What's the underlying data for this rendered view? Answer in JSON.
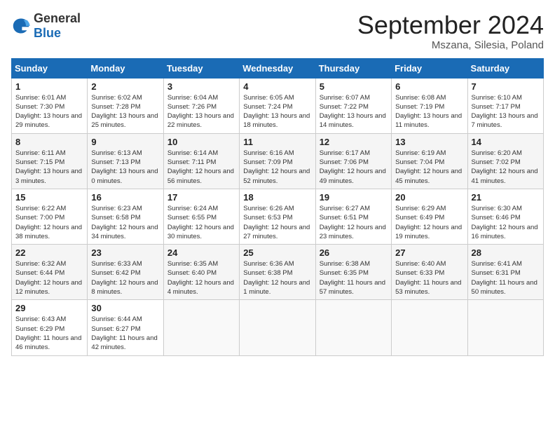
{
  "header": {
    "logo_general": "General",
    "logo_blue": "Blue",
    "month_title": "September 2024",
    "location": "Mszana, Silesia, Poland"
  },
  "calendar": {
    "days_of_week": [
      "Sunday",
      "Monday",
      "Tuesday",
      "Wednesday",
      "Thursday",
      "Friday",
      "Saturday"
    ],
    "weeks": [
      [
        null,
        {
          "day": 2,
          "sunrise": "6:02 AM",
          "sunset": "7:28 PM",
          "daylight": "13 hours and 25 minutes."
        },
        {
          "day": 3,
          "sunrise": "6:04 AM",
          "sunset": "7:26 PM",
          "daylight": "13 hours and 22 minutes."
        },
        {
          "day": 4,
          "sunrise": "6:05 AM",
          "sunset": "7:24 PM",
          "daylight": "13 hours and 18 minutes."
        },
        {
          "day": 5,
          "sunrise": "6:07 AM",
          "sunset": "7:22 PM",
          "daylight": "13 hours and 14 minutes."
        },
        {
          "day": 6,
          "sunrise": "6:08 AM",
          "sunset": "7:19 PM",
          "daylight": "13 hours and 11 minutes."
        },
        {
          "day": 7,
          "sunrise": "6:10 AM",
          "sunset": "7:17 PM",
          "daylight": "13 hours and 7 minutes."
        }
      ],
      [
        {
          "day": 1,
          "sunrise": "6:01 AM",
          "sunset": "7:30 PM",
          "daylight": "13 hours and 29 minutes."
        },
        {
          "day": 8,
          "sunrise": "6:11 AM",
          "sunset": "7:15 PM",
          "daylight": "13 hours and 3 minutes."
        },
        {
          "day": 9,
          "sunrise": "6:13 AM",
          "sunset": "7:13 PM",
          "daylight": "13 hours and 0 minutes."
        },
        {
          "day": 10,
          "sunrise": "6:14 AM",
          "sunset": "7:11 PM",
          "daylight": "12 hours and 56 minutes."
        },
        {
          "day": 11,
          "sunrise": "6:16 AM",
          "sunset": "7:09 PM",
          "daylight": "12 hours and 52 minutes."
        },
        {
          "day": 12,
          "sunrise": "6:17 AM",
          "sunset": "7:06 PM",
          "daylight": "12 hours and 49 minutes."
        },
        {
          "day": 13,
          "sunrise": "6:19 AM",
          "sunset": "7:04 PM",
          "daylight": "12 hours and 45 minutes."
        },
        {
          "day": 14,
          "sunrise": "6:20 AM",
          "sunset": "7:02 PM",
          "daylight": "12 hours and 41 minutes."
        }
      ],
      [
        {
          "day": 15,
          "sunrise": "6:22 AM",
          "sunset": "7:00 PM",
          "daylight": "12 hours and 38 minutes."
        },
        {
          "day": 16,
          "sunrise": "6:23 AM",
          "sunset": "6:58 PM",
          "daylight": "12 hours and 34 minutes."
        },
        {
          "day": 17,
          "sunrise": "6:24 AM",
          "sunset": "6:55 PM",
          "daylight": "12 hours and 30 minutes."
        },
        {
          "day": 18,
          "sunrise": "6:26 AM",
          "sunset": "6:53 PM",
          "daylight": "12 hours and 27 minutes."
        },
        {
          "day": 19,
          "sunrise": "6:27 AM",
          "sunset": "6:51 PM",
          "daylight": "12 hours and 23 minutes."
        },
        {
          "day": 20,
          "sunrise": "6:29 AM",
          "sunset": "6:49 PM",
          "daylight": "12 hours and 19 minutes."
        },
        {
          "day": 21,
          "sunrise": "6:30 AM",
          "sunset": "6:46 PM",
          "daylight": "12 hours and 16 minutes."
        }
      ],
      [
        {
          "day": 22,
          "sunrise": "6:32 AM",
          "sunset": "6:44 PM",
          "daylight": "12 hours and 12 minutes."
        },
        {
          "day": 23,
          "sunrise": "6:33 AM",
          "sunset": "6:42 PM",
          "daylight": "12 hours and 8 minutes."
        },
        {
          "day": 24,
          "sunrise": "6:35 AM",
          "sunset": "6:40 PM",
          "daylight": "12 hours and 4 minutes."
        },
        {
          "day": 25,
          "sunrise": "6:36 AM",
          "sunset": "6:38 PM",
          "daylight": "12 hours and 1 minute."
        },
        {
          "day": 26,
          "sunrise": "6:38 AM",
          "sunset": "6:35 PM",
          "daylight": "11 hours and 57 minutes."
        },
        {
          "day": 27,
          "sunrise": "6:40 AM",
          "sunset": "6:33 PM",
          "daylight": "11 hours and 53 minutes."
        },
        {
          "day": 28,
          "sunrise": "6:41 AM",
          "sunset": "6:31 PM",
          "daylight": "11 hours and 50 minutes."
        }
      ],
      [
        {
          "day": 29,
          "sunrise": "6:43 AM",
          "sunset": "6:29 PM",
          "daylight": "11 hours and 46 minutes."
        },
        {
          "day": 30,
          "sunrise": "6:44 AM",
          "sunset": "6:27 PM",
          "daylight": "11 hours and 42 minutes."
        },
        null,
        null,
        null,
        null,
        null
      ]
    ]
  }
}
